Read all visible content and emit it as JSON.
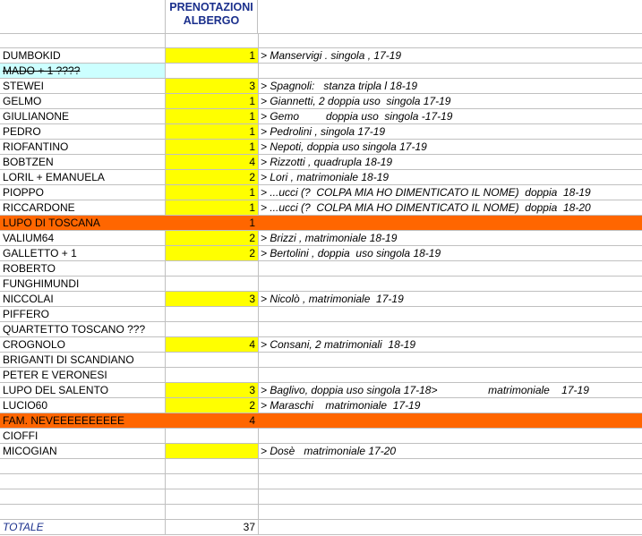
{
  "header": {
    "col_b": "PRENOTAZIONI ALBERGO"
  },
  "colors": {
    "yellow": "#ffff00",
    "orange": "#ff6600",
    "cyan": "#ccffff",
    "header_text": "#1a2f8c"
  },
  "rows": [
    {
      "name": "",
      "qty": "",
      "note": ""
    },
    {
      "name": "DUMBOKID",
      "qty": "1",
      "note": "> Manservigi . singola , 17-19"
    },
    {
      "name": "MADO + 1 ????",
      "qty": "",
      "note": ""
    },
    {
      "name": "STEWEI",
      "qty": "3",
      "note": "> Spagnoli:   stanza tripla l 18-19"
    },
    {
      "name": "GELMO",
      "qty": "1",
      "note": "> Giannetti, 2 doppia uso  singola 17-19"
    },
    {
      "name": "GIULIANONE",
      "qty": "1",
      "note": "> Gemo         doppia uso  singola -17-19"
    },
    {
      "name": "PEDRO",
      "qty": "1",
      "note": "> Pedrolini , singola 17-19"
    },
    {
      "name": "RIOFANTINO",
      "qty": "1",
      "note": "> Nepoti, doppia uso singola 17-19"
    },
    {
      "name": "BOBTZEN",
      "qty": "4",
      "note": "> Rizzotti , quadrupla 18-19"
    },
    {
      "name": "LORIL + EMANUELA",
      "qty": "2",
      "note": "> Lori , matrimoniale 18-19"
    },
    {
      "name": "PIOPPO",
      "qty": "1",
      "note": "> ...ucci (?  COLPA MIA HO DIMENTICATO IL NOME)  doppia  18-19"
    },
    {
      "name": "RICCARDONE",
      "qty": "1",
      "note": "> ...ucci (?  COLPA MIA HO DIMENTICATO IL NOME)  doppia  18-20"
    },
    {
      "name": "LUPO DI TOSCANA",
      "qty": "1",
      "note": ""
    },
    {
      "name": "VALIUM64",
      "qty": "2",
      "note": "> Brizzi , matrimoniale 18-19"
    },
    {
      "name": "GALLETTO + 1",
      "qty": "2",
      "note": "> Bertolini , doppia  uso singola 18-19"
    },
    {
      "name": "ROBERTO",
      "qty": "",
      "note": ""
    },
    {
      "name": "FUNGHIMUNDI",
      "qty": "",
      "note": ""
    },
    {
      "name": "NICCOLAI",
      "qty": "3",
      "note": "> Nicolò , matrimoniale  17-19"
    },
    {
      "name": "PIFFERO",
      "qty": "",
      "note": ""
    },
    {
      "name": "QUARTETTO TOSCANO ???",
      "qty": "",
      "note": ""
    },
    {
      "name": "CROGNOLO",
      "qty": "4",
      "note": "> Consani, 2 matrimoniali  18-19"
    },
    {
      "name": "BRIGANTI DI SCANDIANO",
      "qty": "",
      "note": ""
    },
    {
      "name": "PETER E VERONESI",
      "qty": "",
      "note": ""
    },
    {
      "name": "LUPO DEL SALENTO",
      "qty": "3",
      "note": "> Baglivo, doppia uso singola 17-18>                 matrimoniale    17-19"
    },
    {
      "name": "LUCIO60",
      "qty": "2",
      "note": "> Maraschi    matrimoniale  17-19"
    },
    {
      "name": "FAM. NEVEEEEEEEEEE",
      "qty": "4",
      "note": ""
    },
    {
      "name": "CIOFFI",
      "qty": "",
      "note": ""
    },
    {
      "name": "MICOGIAN",
      "qty": "",
      "note": "> Dosè   matrimoniale 17-20"
    },
    {
      "name": "",
      "qty": "",
      "note": ""
    },
    {
      "name": "",
      "qty": "",
      "note": ""
    },
    {
      "name": "",
      "qty": "",
      "note": ""
    },
    {
      "name": "",
      "qty": "",
      "note": ""
    },
    {
      "name": "TOTALE",
      "qty": "37",
      "note": ""
    }
  ]
}
